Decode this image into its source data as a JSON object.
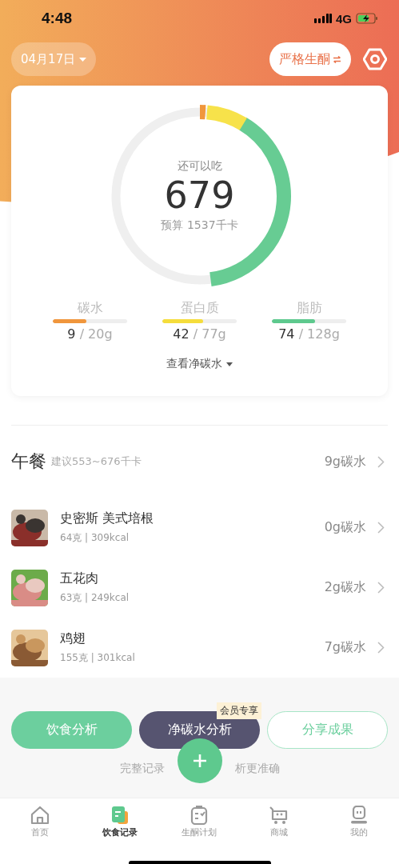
{
  "status_bar": {
    "time": "4:48",
    "network": "4G"
  },
  "header": {
    "date": "04月17日",
    "plan": "严格生酮"
  },
  "summary": {
    "label": "还可以吃",
    "remaining": "679",
    "budget": "预算 1537千卡"
  },
  "macros": [
    {
      "name": "碳水",
      "eaten": "9",
      "target": " / 20g",
      "level": 0.45,
      "color": "#f0963c"
    },
    {
      "name": "蛋白质",
      "eaten": "42",
      "target": " / 77g",
      "level": 0.55,
      "color": "#f5dd3c"
    },
    {
      "name": "脂肪",
      "eaten": "74",
      "target": " / 128g",
      "level": 0.58,
      "color": "#5ec98e"
    }
  ],
  "net_carb_toggle": "查看净碳水",
  "meal": {
    "title": "午餐",
    "suggestion": "建议553~676千卡",
    "carbs": "9g碳水",
    "items": [
      {
        "name": "史密斯 美式培根",
        "detail": "64克 | 309kcal",
        "carbs": "0g碳水",
        "kind": "picture"
      },
      {
        "name": "五花肉",
        "detail": "63克 | 249kcal",
        "carbs": "2g碳水",
        "kind": "picture"
      },
      {
        "name": "鸡翅",
        "detail": "155克 | 301kcal",
        "carbs": "7g碳水",
        "kind": "picture"
      }
    ]
  },
  "actions": [
    {
      "label": "饮食分析",
      "kind": "filled"
    },
    {
      "label": "净碳水分析",
      "kind": "dark",
      "badge": "会员专享"
    },
    {
      "label": "分享成果",
      "kind": "outline"
    }
  ],
  "hint_left": "完整记录",
  "hint_right": "析更准确",
  "tabs": [
    {
      "label": "首页",
      "kind": "home",
      "selected": false
    },
    {
      "label": "饮食记录",
      "kind": "record",
      "selected": true
    },
    {
      "label": "生酮计划",
      "kind": "plan",
      "selected": false
    },
    {
      "label": "商城",
      "kind": "shop",
      "selected": false
    },
    {
      "label": "我的",
      "kind": "me",
      "selected": false
    }
  ]
}
